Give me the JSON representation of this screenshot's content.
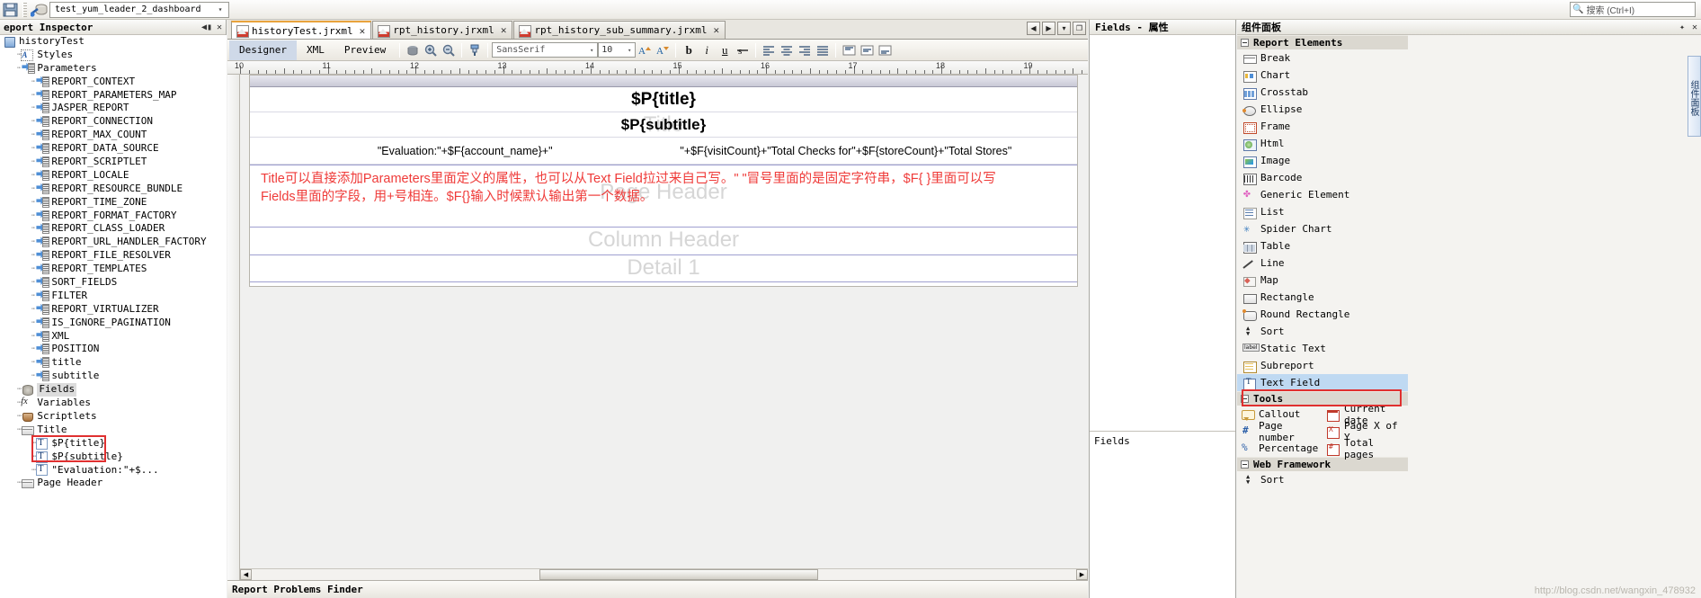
{
  "topbar": {
    "save_icon": "save-icon",
    "connection_icon": "datasource-icon",
    "datasource_value": "test_yum_leader_2_dashboard",
    "dropdown_arrow": "▾",
    "search_placeholder": "搜索 (Ctrl+I)",
    "search_icon": "search-icon"
  },
  "inspector": {
    "title": "eport Inspector",
    "collapse_label": "◀▮",
    "close_label": "✕",
    "nodes": [
      {
        "label": "historyTest",
        "depth": 0,
        "icon": "report-root-icon"
      },
      {
        "label": "Styles",
        "depth": 1,
        "icon": "styles-icon"
      },
      {
        "label": "Parameters",
        "depth": 1,
        "icon": "parameters-icon"
      },
      {
        "label": "REPORT_CONTEXT",
        "depth": 2,
        "icon": "parameter-icon"
      },
      {
        "label": "REPORT_PARAMETERS_MAP",
        "depth": 2,
        "icon": "parameter-icon"
      },
      {
        "label": "JASPER_REPORT",
        "depth": 2,
        "icon": "parameter-icon"
      },
      {
        "label": "REPORT_CONNECTION",
        "depth": 2,
        "icon": "parameter-icon"
      },
      {
        "label": "REPORT_MAX_COUNT",
        "depth": 2,
        "icon": "parameter-icon"
      },
      {
        "label": "REPORT_DATA_SOURCE",
        "depth": 2,
        "icon": "parameter-icon"
      },
      {
        "label": "REPORT_SCRIPTLET",
        "depth": 2,
        "icon": "parameter-icon"
      },
      {
        "label": "REPORT_LOCALE",
        "depth": 2,
        "icon": "parameter-icon"
      },
      {
        "label": "REPORT_RESOURCE_BUNDLE",
        "depth": 2,
        "icon": "parameter-icon"
      },
      {
        "label": "REPORT_TIME_ZONE",
        "depth": 2,
        "icon": "parameter-icon"
      },
      {
        "label": "REPORT_FORMAT_FACTORY",
        "depth": 2,
        "icon": "parameter-icon"
      },
      {
        "label": "REPORT_CLASS_LOADER",
        "depth": 2,
        "icon": "parameter-icon"
      },
      {
        "label": "REPORT_URL_HANDLER_FACTORY",
        "depth": 2,
        "icon": "parameter-icon"
      },
      {
        "label": "REPORT_FILE_RESOLVER",
        "depth": 2,
        "icon": "parameter-icon"
      },
      {
        "label": "REPORT_TEMPLATES",
        "depth": 2,
        "icon": "parameter-icon"
      },
      {
        "label": "SORT_FIELDS",
        "depth": 2,
        "icon": "parameter-icon"
      },
      {
        "label": "FILTER",
        "depth": 2,
        "icon": "parameter-icon"
      },
      {
        "label": "REPORT_VIRTUALIZER",
        "depth": 2,
        "icon": "parameter-icon"
      },
      {
        "label": "IS_IGNORE_PAGINATION",
        "depth": 2,
        "icon": "parameter-icon"
      },
      {
        "label": "XML",
        "depth": 2,
        "icon": "parameter-icon"
      },
      {
        "label": "POSITION",
        "depth": 2,
        "icon": "parameter-icon"
      },
      {
        "label": "title",
        "depth": 2,
        "icon": "parameter-icon"
      },
      {
        "label": "subtitle",
        "depth": 2,
        "icon": "parameter-icon"
      },
      {
        "label": "Fields",
        "depth": 1,
        "icon": "fields-icon",
        "highlighted": true
      },
      {
        "label": "Variables",
        "depth": 1,
        "icon": "variables-icon"
      },
      {
        "label": "Scriptlets",
        "depth": 1,
        "icon": "scriptlets-icon"
      },
      {
        "label": "Title",
        "depth": 1,
        "icon": "band-icon"
      },
      {
        "label": "$P{title}",
        "depth": 2,
        "icon": "textfield-icon"
      },
      {
        "label": "$P{subtitle}",
        "depth": 2,
        "icon": "textfield-icon"
      },
      {
        "label": "\"Evaluation:\"+$...",
        "depth": 2,
        "icon": "textfield-icon"
      },
      {
        "label": "Page Header",
        "depth": 1,
        "icon": "band-icon"
      }
    ]
  },
  "editor": {
    "tabs": [
      {
        "label": "historyTest.jrxml",
        "active": true,
        "close": "✕"
      },
      {
        "label": "rpt_history.jrxml",
        "active": false,
        "close": "✕"
      },
      {
        "label": "rpt_history_sub_summary.jrxml",
        "active": false,
        "close": "✕"
      }
    ],
    "nav_buttons": [
      "◀",
      "▶",
      "▾",
      "❐"
    ],
    "view_tabs": [
      {
        "label": "Designer",
        "selected": true
      },
      {
        "label": "XML",
        "selected": false
      },
      {
        "label": "Preview",
        "selected": false
      }
    ],
    "toolbar_icons": [
      "print-preview-icon",
      "zoom-in-icon",
      "zoom-out-icon",
      "format-painter-icon"
    ],
    "font_family": "SansSerif",
    "font_size": "10",
    "format_icons": [
      "increase-font-icon",
      "decrease-font-icon",
      "bold-icon",
      "italic-icon",
      "underline-icon",
      "strikethrough-icon",
      "align-left-icon",
      "align-center-icon",
      "align-right-icon",
      "align-justify-icon",
      "valign-top-icon",
      "valign-middle-icon",
      "valign-bottom-icon"
    ],
    "bold_label": "b",
    "italic_label": "i",
    "underline_label": "u",
    "ruler_numbers": [
      "10",
      "11",
      "12",
      "13",
      "14",
      "15",
      "16",
      "17",
      "18",
      "19"
    ],
    "canvas": {
      "title_text": "$P{title}",
      "subtitle_text": "$P{subtitle}",
      "eval_left": "\"Evaluation:\"+$F{account_name}+\"",
      "eval_right": "\"+$F{visitCount}+\"Total Checks for\"+$F{storeCount}+\"Total Stores\"",
      "note_line1": "Title可以直接添加Parameters里面定义的属性，也可以从Text Field拉过来自己写。\" \"冒号里面的是固定字符串，$F{ }里面可以写",
      "note_line2": "Fields里面的字段，用+号相连。$F{}输入时候默认输出第一个数据。",
      "ghost_title": "Title",
      "ghost_page_header": "Page Header",
      "column_header_label": "Column Header",
      "detail_label": "Detail 1",
      "note_color": "#ef3b39"
    },
    "problems_title": "Report Problems Finder",
    "scroll_left_arrow": "◀",
    "scroll_right_arrow": "▶"
  },
  "fields_panel": {
    "title": "Fields - 属性",
    "lower_label": "Fields"
  },
  "palette": {
    "title": "组件面板",
    "pin_icon": "pin-icon",
    "close_icon": "close-icon",
    "groups": [
      {
        "name": "Report Elements",
        "items": [
          {
            "label": "Break",
            "icon": "break-icon",
            "cls": "i-break"
          },
          {
            "label": "Chart",
            "icon": "chart-icon",
            "cls": "i-chart"
          },
          {
            "label": "Crosstab",
            "icon": "crosstab-icon",
            "cls": "i-cross"
          },
          {
            "label": "Ellipse",
            "icon": "ellipse-icon",
            "cls": "i-ellipse"
          },
          {
            "label": "Frame",
            "icon": "frame-icon",
            "cls": "i-frame"
          },
          {
            "label": "Html",
            "icon": "html-icon",
            "cls": "i-html"
          },
          {
            "label": "Image",
            "icon": "image-icon",
            "cls": "i-image"
          },
          {
            "label": "Barcode",
            "icon": "barcode-icon",
            "cls": "i-barcode"
          },
          {
            "label": "Generic Element",
            "icon": "generic-element-icon",
            "cls": "i-generic"
          },
          {
            "label": "List",
            "icon": "list-icon",
            "cls": "i-list"
          },
          {
            "label": "Spider Chart",
            "icon": "spider-chart-icon",
            "cls": "i-spider"
          },
          {
            "label": "Table",
            "icon": "table-icon",
            "cls": "i-table"
          },
          {
            "label": "Line",
            "icon": "line-icon",
            "cls": "i-line"
          },
          {
            "label": "Map",
            "icon": "map-icon",
            "cls": "i-map"
          },
          {
            "label": "Rectangle",
            "icon": "rectangle-icon",
            "cls": "i-rect"
          },
          {
            "label": "Round Rectangle",
            "icon": "round-rectangle-icon",
            "cls": "i-rrect"
          },
          {
            "label": "Sort",
            "icon": "sort-icon",
            "cls": "i-sort"
          },
          {
            "label": "Static Text",
            "icon": "static-text-icon",
            "cls": "i-stext"
          },
          {
            "label": "Subreport",
            "icon": "subreport-icon",
            "cls": "i-sub"
          },
          {
            "label": "Text Field",
            "icon": "text-field-icon",
            "cls": "i-tfield",
            "selected": true
          }
        ]
      },
      {
        "name": "Tools",
        "grid": true,
        "items": [
          {
            "label": "Callout",
            "icon": "callout-icon",
            "cls": "i-callout"
          },
          {
            "label": "Current date",
            "icon": "current-date-icon",
            "cls": "i-curdate"
          },
          {
            "label": "Page number",
            "icon": "page-number-icon",
            "cls": "i-pagenum"
          },
          {
            "label": "Page X of Y",
            "icon": "page-x-of-y-icon",
            "cls": "i-pagexy"
          },
          {
            "label": "Percentage",
            "icon": "percentage-icon",
            "cls": "i-pct"
          },
          {
            "label": "Total pages",
            "icon": "total-pages-icon",
            "cls": "i-total"
          }
        ]
      },
      {
        "name": "Web Framework",
        "items": [
          {
            "label": "Sort",
            "icon": "web-sort-icon",
            "cls": "i-wsort"
          }
        ]
      }
    ],
    "side_tab": "组件面板",
    "watermark": "http://blog.csdn.net/wangxin_478932"
  }
}
